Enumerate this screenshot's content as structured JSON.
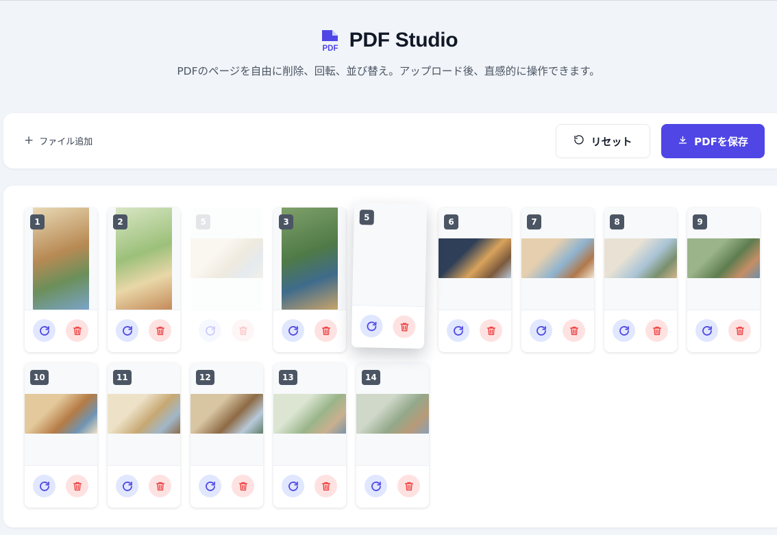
{
  "app": {
    "title": "PDF Studio",
    "logo_text": "PDF",
    "subtitle": "PDFのページを自由に削除、回転、並び替え。アップロード後、直感的に操作できます。"
  },
  "toolbar": {
    "add_file_label": "ファイル追加",
    "reset_label": "リセット",
    "save_label": "PDFを保存"
  },
  "colors": {
    "accent": "#4f46e5",
    "rotate_bg": "#e0e7ff",
    "delete_bg": "#fee2e2",
    "delete_icon": "#ef4444",
    "badge_bg": "#4b5563"
  },
  "pages": [
    {
      "num": "1",
      "orientation": "portrait",
      "state": "normal"
    },
    {
      "num": "2",
      "orientation": "portrait",
      "state": "normal"
    },
    {
      "num": "5",
      "orientation": "landscape",
      "state": "placeholder"
    },
    {
      "num": "3",
      "orientation": "portrait",
      "state": "normal"
    },
    {
      "num": "5",
      "orientation": "landscape",
      "state": "dragging"
    },
    {
      "num": "6",
      "orientation": "landscape",
      "state": "normal"
    },
    {
      "num": "7",
      "orientation": "landscape",
      "state": "normal"
    },
    {
      "num": "8",
      "orientation": "landscape",
      "state": "normal"
    },
    {
      "num": "9",
      "orientation": "landscape",
      "state": "normal"
    },
    {
      "num": "10",
      "orientation": "landscape",
      "state": "normal"
    },
    {
      "num": "11",
      "orientation": "landscape",
      "state": "normal"
    },
    {
      "num": "12",
      "orientation": "landscape",
      "state": "normal"
    },
    {
      "num": "13",
      "orientation": "landscape",
      "state": "normal"
    },
    {
      "num": "14",
      "orientation": "landscape",
      "state": "normal"
    }
  ],
  "icons": {
    "rotate": "rotate-cw-icon",
    "delete": "trash-icon",
    "reset": "undo-icon",
    "save": "download-icon",
    "add": "plus-icon"
  }
}
